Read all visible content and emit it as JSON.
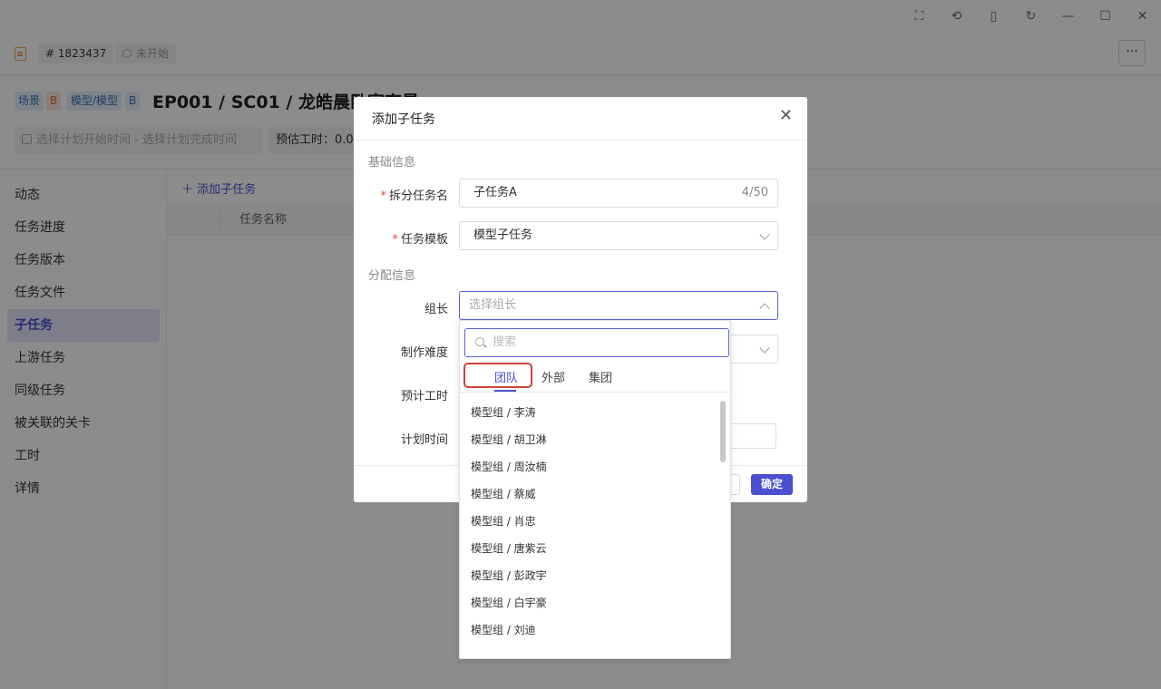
{
  "window": {
    "icons": [
      "presentation-icon",
      "history-icon",
      "clipboard-icon",
      "refresh-icon",
      "minimize-icon",
      "maximize-icon",
      "close-icon"
    ],
    "glyphs": [
      "⛶",
      "⟲",
      "▯",
      "↻",
      "—",
      "☐",
      "✕"
    ]
  },
  "header": {
    "id": "# 1823437",
    "status": "未开始",
    "more": "···",
    "tags": [
      {
        "label": "场景",
        "color": "#3a6fb6"
      },
      {
        "label": "B",
        "color": "#e06a2d"
      },
      {
        "label": "模型/模型",
        "color": "#3a6fb6"
      },
      {
        "label": "B",
        "color": "#3a6fb6"
      }
    ],
    "title": "EP001 / SC01 / 龙皓晨卧室夜景",
    "date_range": "选择计划开始时间 - 选择计划完成时间",
    "est_hours": "预估工时：0.0"
  },
  "sidebar": {
    "items": [
      {
        "label": "动态"
      },
      {
        "label": "任务进度"
      },
      {
        "label": "任务版本"
      },
      {
        "label": "任务文件"
      },
      {
        "label": "子任务",
        "active": true
      },
      {
        "label": "上游任务"
      },
      {
        "label": "同级任务"
      },
      {
        "label": "被关联的关卡"
      },
      {
        "label": "工时"
      },
      {
        "label": "详情"
      }
    ]
  },
  "main": {
    "add_subtask": "添加子任务",
    "column": "任务名称"
  },
  "modal": {
    "title": "添加子任务",
    "close": "✕",
    "basic_section": "基础信息",
    "assign_section": "分配信息",
    "fields": {
      "name_label": "拆分任务名",
      "name_value": "子任务A",
      "name_counter": "4/50",
      "template_label": "任务模板",
      "template_value": "模型子任务",
      "leader_label": "组长",
      "leader_placeholder": "选择组长",
      "difficulty_label": "制作难度",
      "hours_label": "预计工时",
      "schedule_label": "计划时间"
    },
    "ok": "确定"
  },
  "dropdown": {
    "search_placeholder": "搜索",
    "tabs": [
      {
        "label": "团队",
        "active": true
      },
      {
        "label": "外部"
      },
      {
        "label": "集团"
      }
    ],
    "items": [
      "模型组 / 李涛",
      "模型组 / 胡卫淋",
      "模型组 / 周汝楠",
      "模型组 / 蔡威",
      "模型组 / 肖忠",
      "模型组 / 唐紫云",
      "模型组 / 彭政宇",
      "模型组 / 白宇豪",
      "模型组 / 刘迪"
    ]
  }
}
